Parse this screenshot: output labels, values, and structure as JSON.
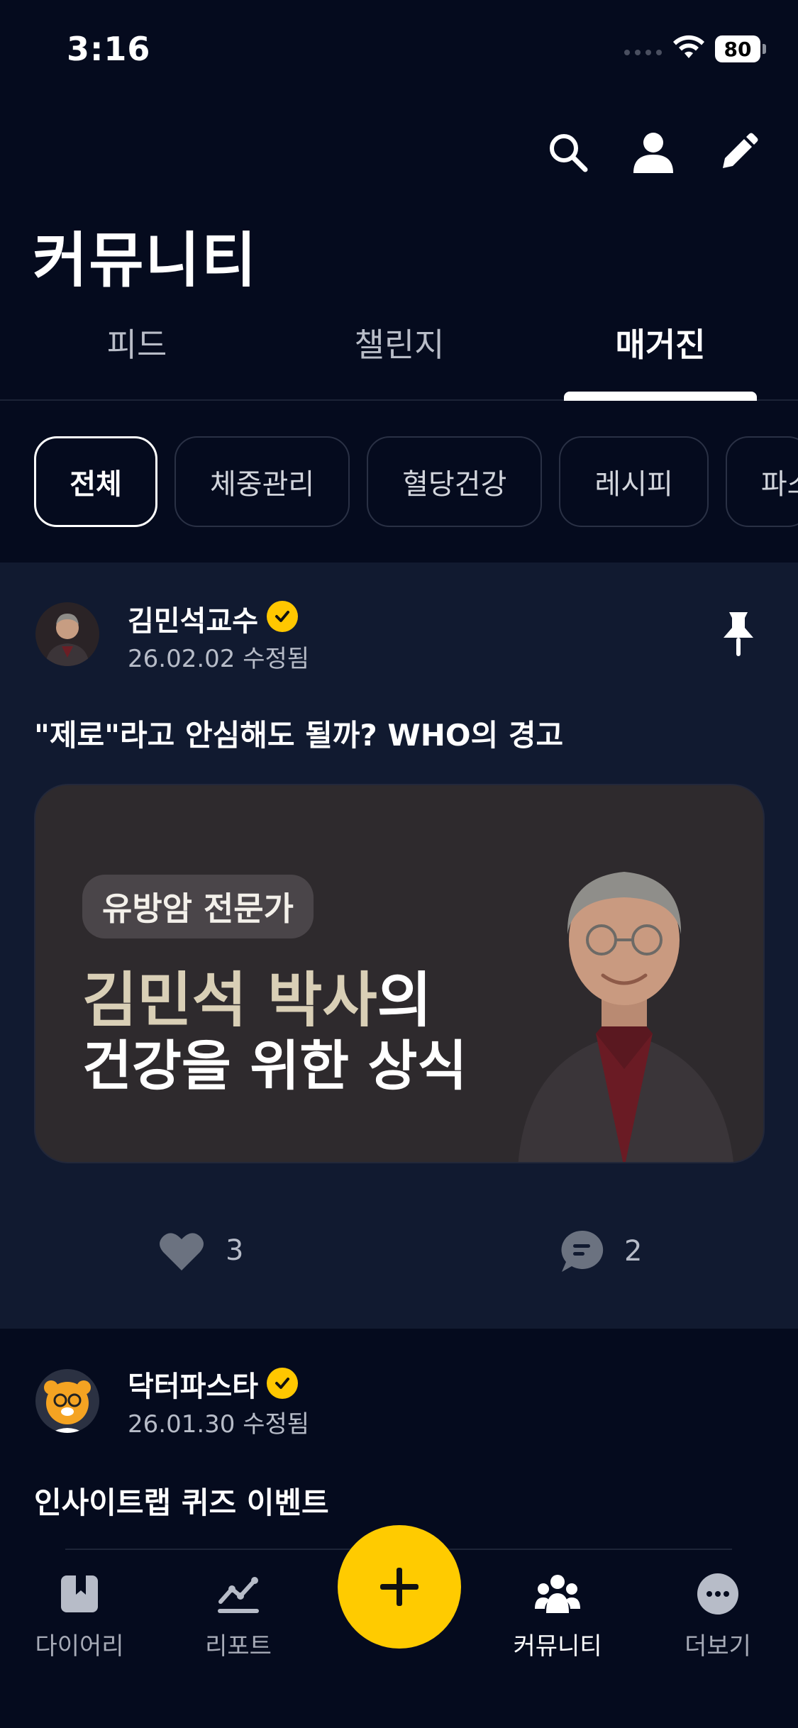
{
  "status_bar": {
    "time": "3:16",
    "battery": "80"
  },
  "header": {
    "title": "커뮤니티",
    "icons": [
      "search-icon",
      "profile-icon",
      "edit-icon"
    ]
  },
  "tabs": [
    {
      "label": "피드",
      "active": false
    },
    {
      "label": "챌린지",
      "active": false
    },
    {
      "label": "매거진",
      "active": true
    }
  ],
  "chips": [
    "전체",
    "체중관리",
    "혈당건강",
    "레시피",
    "파스"
  ],
  "posts": [
    {
      "author": "김민석교수",
      "date": "26.02.02 수정됨",
      "title": "\"제로\"라고 안심해도 될까? WHO의 경고",
      "banner": {
        "badge": "유방암 전문가",
        "line1_highlight": "김민석 박사",
        "line1_rest": "의",
        "line2": "건강을 위한 상식"
      },
      "likes": "3",
      "comments": "2",
      "pinned": true
    },
    {
      "author": "닥터파스타",
      "date": "26.01.30 수정됨",
      "title": "인사이트랩 퀴즈 이벤트"
    }
  ],
  "bottom_nav": [
    {
      "label": "다이어리",
      "icon": "diary-icon"
    },
    {
      "label": "리포트",
      "icon": "report-icon"
    },
    {
      "label": "커뮤니티",
      "icon": "community-icon",
      "active": true
    },
    {
      "label": "더보기",
      "icon": "more-icon"
    }
  ],
  "colors": {
    "background": "#050b1e",
    "card": "#111a30",
    "accent": "#ffcb00",
    "verified": "#ffc700"
  }
}
